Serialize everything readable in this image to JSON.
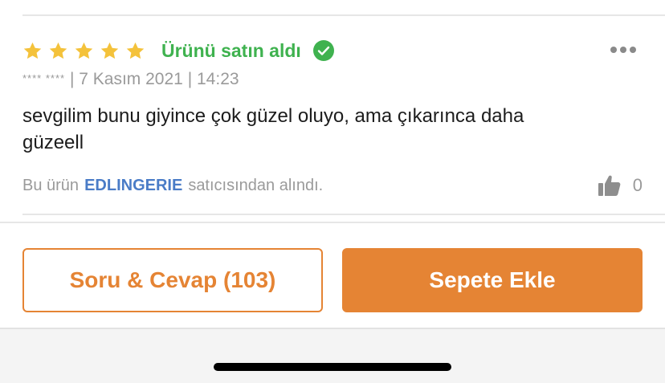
{
  "review": {
    "rating": 5,
    "rating_max": 5,
    "verified_label": "Ürünü satın aldı",
    "reviewer_masked": "**** ****",
    "separator": "|",
    "date": "7 Kasım 2021",
    "time": "14:23",
    "comment": "sevgilim bunu giyince çok güzel oluyo, ama çıkarınca daha güzeell",
    "seller_prefix": "Bu ürün",
    "seller_name": "EDLINGERIE",
    "seller_suffix": "satıcısından alındı.",
    "like_count": "0"
  },
  "actions": {
    "qa_label": "Soru & Cevap (103)",
    "cart_label": "Sepete Ekle"
  },
  "colors": {
    "star": "#f4c23b",
    "verified": "#3fb24f",
    "seller_link": "#4a7cc7",
    "accent": "#e58434"
  },
  "icons": {
    "rating": "star-icon",
    "verified": "check-circle-icon",
    "menu": "more-horizontal-icon",
    "like": "thumbs-up-icon"
  }
}
